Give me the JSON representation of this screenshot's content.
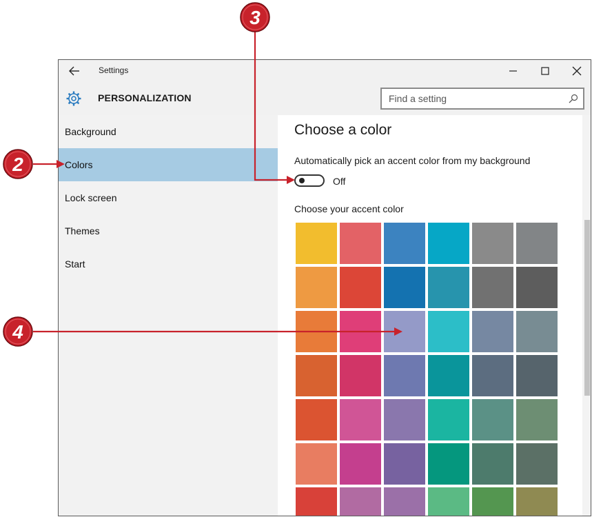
{
  "window": {
    "title": "Settings"
  },
  "header": {
    "heading": "PERSONALIZATION",
    "search_placeholder": "Find a setting"
  },
  "sidebar": {
    "selected_index": 1,
    "items": [
      {
        "label": "Background"
      },
      {
        "label": "Colors"
      },
      {
        "label": "Lock screen"
      },
      {
        "label": "Themes"
      },
      {
        "label": "Start"
      }
    ]
  },
  "content": {
    "title": "Choose a color",
    "auto_label": "Automatically pick an accent color from my background",
    "toggle_state": "Off",
    "accent_label": "Choose your accent color",
    "swatches": [
      [
        "#f2bd2e",
        "#e36266",
        "#3c83c0",
        "#06a7c6",
        "#8a8a8a",
        "#828587"
      ],
      [
        "#ee9a42",
        "#dc4637",
        "#1472b0",
        "#2794ad",
        "#717171",
        "#5d5d5d"
      ],
      [
        "#e87b39",
        "#df3e78",
        "#949ac8",
        "#2cbec8",
        "#7688a2",
        "#788c93"
      ],
      [
        "#d86230",
        "#d13567",
        "#6e79b0",
        "#0a959b",
        "#5c6d80",
        "#56646c"
      ],
      [
        "#db5431",
        "#d05596",
        "#8a77ad",
        "#1bb5a1",
        "#5b9186",
        "#6d8e73"
      ],
      [
        "#e87d61",
        "#c43f8e",
        "#7762a0",
        "#05977e",
        "#4d7b6c",
        "#5b7066"
      ],
      [
        "#d84139",
        "#b16ba2",
        "#9b70a8",
        "#5bba84",
        "#549650",
        "#8f8a52"
      ]
    ]
  },
  "callouts": [
    {
      "label": "2"
    },
    {
      "label": "3"
    },
    {
      "label": "4"
    }
  ],
  "colors": {
    "selected_nav": "#a6cbe3",
    "callout_red": "#c8222b",
    "gear_blue": "#2b7cc0",
    "panel_gray": "#f2f2f2"
  }
}
